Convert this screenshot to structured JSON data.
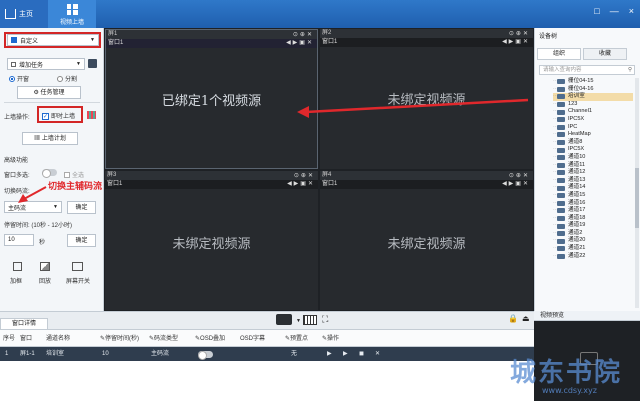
{
  "topbar": {
    "home_label": "主页",
    "video_wall_label": "视频上墙",
    "window_controls": [
      "□",
      "—",
      "×"
    ]
  },
  "left": {
    "layout_select": "自定义",
    "task_select": "增加任务",
    "mode_open": "开窗",
    "mode_split": "分割",
    "task_manage_button": "任务管理",
    "wall_op_label": "上墙操作:",
    "instant_wall_label": "即时上墙",
    "wall_plan_button": "上墙计划",
    "advanced_title": "高级功能",
    "multi_select_label": "窗口多选:",
    "select_all_label": "全选",
    "stream_switch_label": "切换码流:",
    "annotation_text": "切换主辅码流",
    "stream_select": "主码流",
    "confirm_button_1": "确定",
    "dwell_label": "停留时间: (10秒 - 12小时)",
    "dwell_value": "10",
    "dwell_unit": "秒",
    "confirm_button_2": "确定",
    "tools": [
      "加框",
      "回放",
      "屏幕开关"
    ]
  },
  "video": {
    "screens": [
      {
        "screen": "屏1",
        "window": "窗口1",
        "message": "已绑定1个视频源"
      },
      {
        "screen": "屏2",
        "window": "窗口1",
        "message": "未绑定视频源"
      },
      {
        "screen": "屏3",
        "window": "窗口1",
        "message": "未绑定视频源"
      },
      {
        "screen": "屏4",
        "window": "窗口1",
        "message": "未绑定视频源"
      }
    ]
  },
  "right": {
    "title": "设备树",
    "tab_group": "组织",
    "tab_favorite": "收藏",
    "search_placeholder": "请输入查询内容",
    "items": [
      "栅位04-15",
      "栅位04-16",
      "培训室",
      "123",
      "Channel1",
      "IPC5X",
      "IPC",
      "HeatMap",
      "通道8",
      "IPC5X",
      "通道10",
      "通道11",
      "通道12",
      "通道13",
      "通道14",
      "通道15",
      "通道16",
      "通道17",
      "通道18",
      "通道19",
      "通道2",
      "通道20",
      "通道21",
      "通道22"
    ],
    "selected_index": 2
  },
  "bottom": {
    "detail_tab": "窗口详情",
    "columns": [
      "序号",
      "窗口",
      "通道名称",
      "停留时间(秒)",
      "码流类型",
      "OSD叠加",
      "OSD字幕",
      "预置点",
      "操作"
    ],
    "row": {
      "index": "1",
      "window": "屏1-1",
      "channel": "培训室",
      "dwell": "10",
      "stream": "主码流",
      "preset": "无",
      "ops": [
        "▶",
        "▶",
        "◼",
        "✕"
      ]
    }
  },
  "preview": {
    "title": "视频预览"
  },
  "watermark": {
    "text": "城东书院",
    "url": "www.cdsy.xyz"
  },
  "colors": {
    "accent": "#1f5fae",
    "highlight_red": "#d32626",
    "selection": "#f3dca8"
  }
}
